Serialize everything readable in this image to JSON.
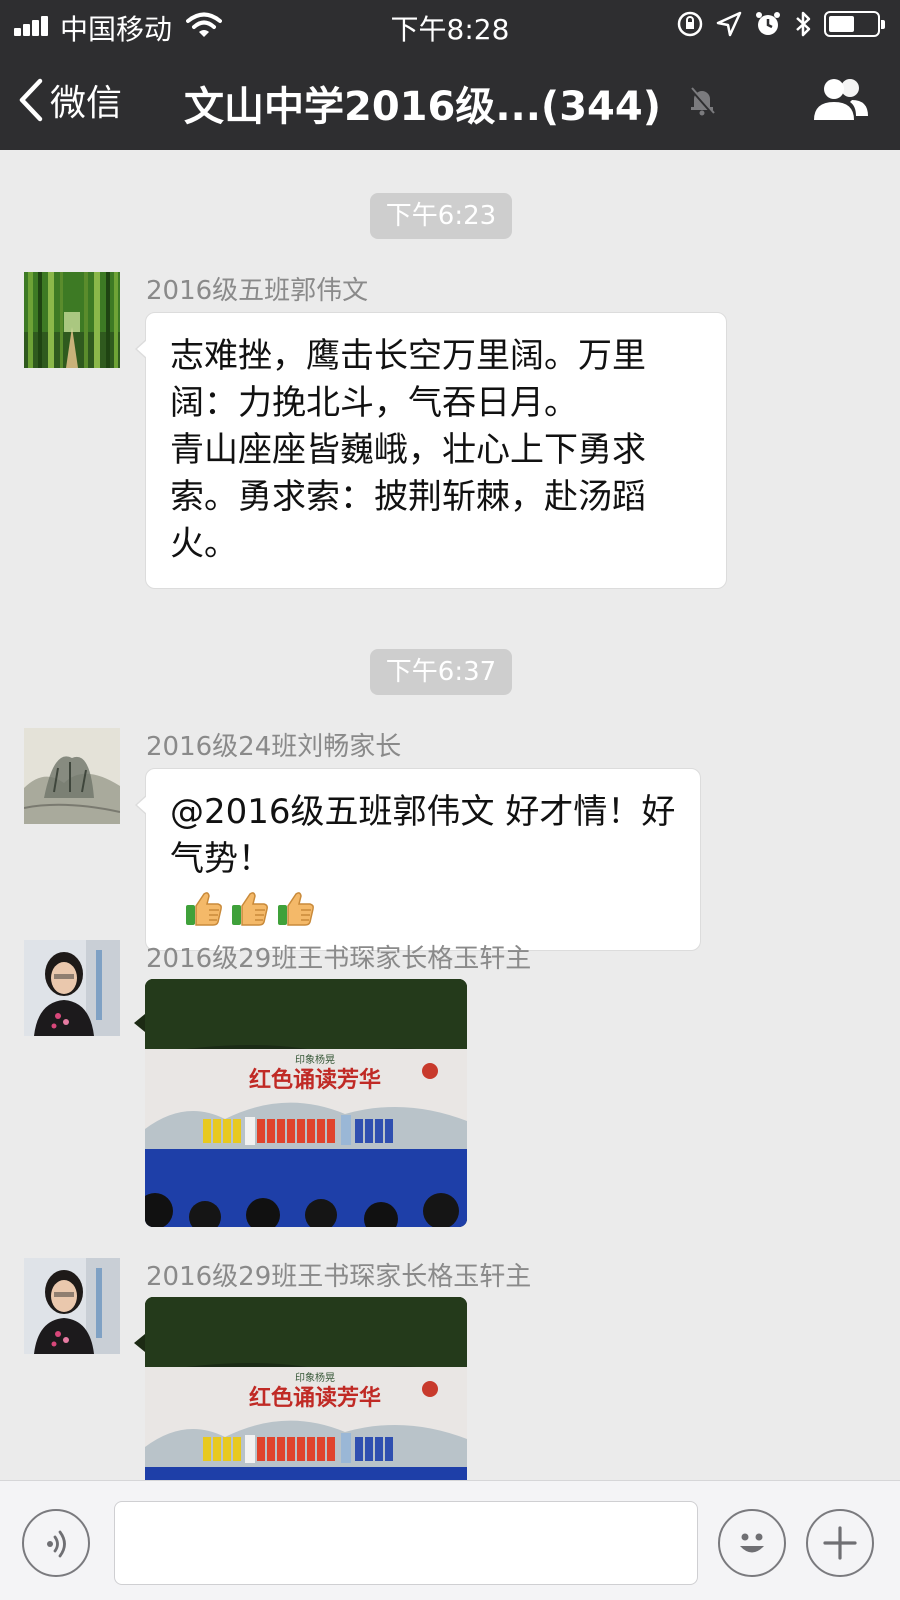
{
  "status_bar": {
    "carrier": "中国移动",
    "time": "下午8:28"
  },
  "nav": {
    "back_label": "微信",
    "title": "文山中学2016级...(344)"
  },
  "messages": [
    {
      "type": "time",
      "text": "下午6:23"
    },
    {
      "type": "text",
      "sender": "2016级五班郭伟文",
      "lines": [
        "志难挫，鹰击长空万里阔。万里阔：力挽北斗，气吞日月。",
        "青山座座皆巍峨，壮心上下勇求索。勇求索：披荆斩棘，赴汤蹈火。"
      ]
    },
    {
      "type": "time",
      "text": "下午6:37"
    },
    {
      "type": "text",
      "sender": "2016级24班刘畅家长",
      "lines": [
        "@2016级五班郭伟文 好才情！好气势！"
      ],
      "emoji": [
        "thumbs-up",
        "thumbs-up",
        "thumbs-up"
      ]
    },
    {
      "type": "image",
      "sender": "2016级29班王书琛家长格玉轩主",
      "banner_text": "红色诵读芳华",
      "banner_top": "印象杨晃"
    },
    {
      "type": "image",
      "sender": "2016级29班王书琛家长格玉轩主",
      "banner_text": "红色诵读芳华",
      "banner_top": "印象杨晃"
    }
  ],
  "input_bar": {
    "voice_icon": "voice-icon",
    "emoji_icon": "emoji-icon",
    "plus_icon": "plus-icon"
  },
  "battery": {
    "level": 0.55
  },
  "colors": {
    "nav_bg": "#2e2e30",
    "chat_bg": "#ebebeb",
    "time_pill": "#cecece"
  }
}
